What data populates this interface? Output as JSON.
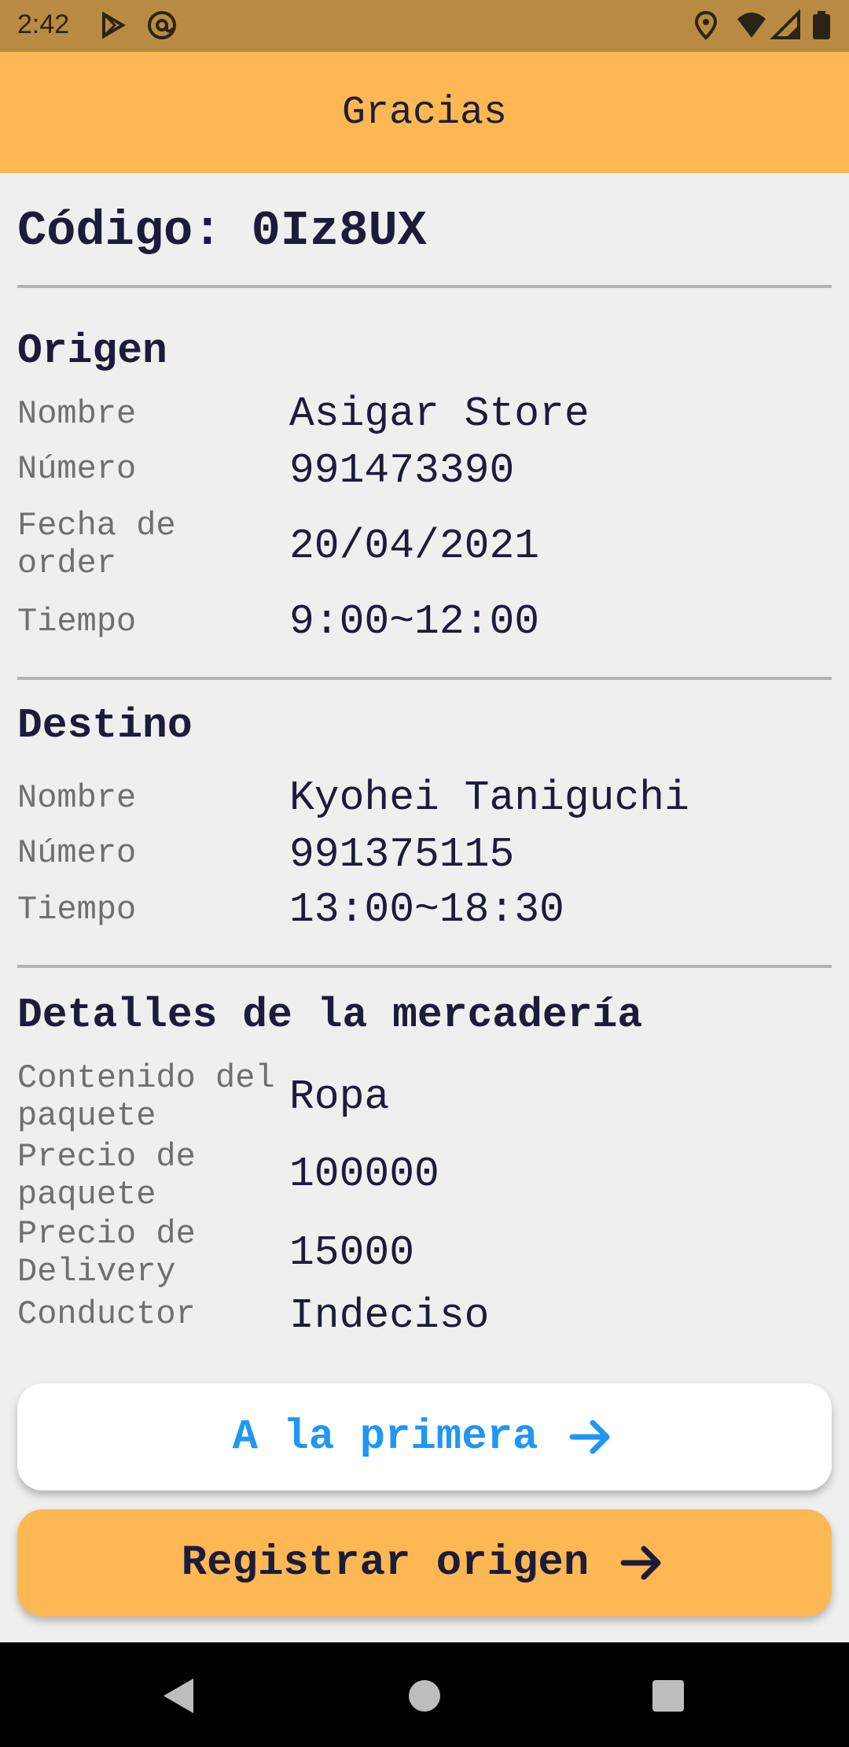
{
  "status_bar": {
    "time": "2:42",
    "icons": [
      "play-store-icon",
      "at-sign-icon",
      "location-icon",
      "wifi-icon",
      "signal-icon",
      "battery-icon"
    ]
  },
  "app_bar": {
    "title": "Gracias"
  },
  "code": {
    "label": "Código: 0Iz8UX"
  },
  "origin": {
    "title": "Origen",
    "rows": [
      {
        "label": "Nombre",
        "value": "Asigar Store"
      },
      {
        "label": "Número",
        "value": "991473390"
      },
      {
        "label": "Fecha de order",
        "value": "20/04/2021"
      },
      {
        "label": "Tiempo",
        "value": "9:00~12:00"
      }
    ]
  },
  "destination": {
    "title": "Destino",
    "rows": [
      {
        "label": "Nombre",
        "value": "Kyohei Taniguchi"
      },
      {
        "label": "Número",
        "value": "991375115"
      },
      {
        "label": "Tiempo",
        "value": "13:00~18:30"
      }
    ]
  },
  "details": {
    "title": "Detalles de la mercadería",
    "rows": [
      {
        "label": "Contenido del paquete",
        "value": "Ropa"
      },
      {
        "label": "Precio de paquete",
        "value": "100000"
      },
      {
        "label": "Precio de Delivery",
        "value": "15000"
      },
      {
        "label": "Conductor",
        "value": "Indeciso"
      }
    ]
  },
  "buttons": {
    "first_label": "A la primera",
    "register_label": "Registrar origen"
  },
  "colors": {
    "accent": "#fdb853",
    "status_bar": "#b98b42",
    "link_blue": "#2196f3",
    "text_dark": "#1c1c3a"
  }
}
